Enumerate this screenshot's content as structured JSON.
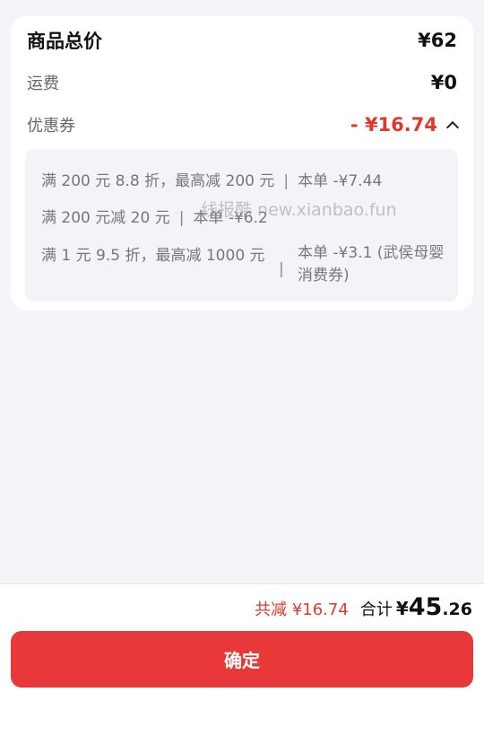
{
  "summary_card": {
    "goods_total_label": "商品总价",
    "goods_total_value": "¥62",
    "shipping_label": "运费",
    "shipping_value": "¥0",
    "coupon_label": "优惠券",
    "coupon_value": "- ¥16.74"
  },
  "coupons": [
    {
      "rule": "满 200 元 8.8 折，最高减 200 元",
      "sep": "|",
      "saving": "本单 -¥7.44"
    },
    {
      "rule": "满 200 元减 20 元",
      "sep": "|",
      "saving": "本单 -¥6.2"
    },
    {
      "rule": "满 1 元 9.5 折，最高减 1000 元",
      "sep": "|",
      "saving": "本单 -¥3.1 (武侯母婴消费券)"
    }
  ],
  "watermark": "线报酷 new.xianbao.fun",
  "footer": {
    "saved_text": "共减 ¥16.74",
    "total_label": "合计",
    "total_currency": "¥",
    "total_int": "45",
    "total_dec": ".26",
    "confirm_label": "确定"
  },
  "colors": {
    "accent": "#e8383a",
    "price_red": "#e0392b",
    "background": "#f4f5f9"
  }
}
